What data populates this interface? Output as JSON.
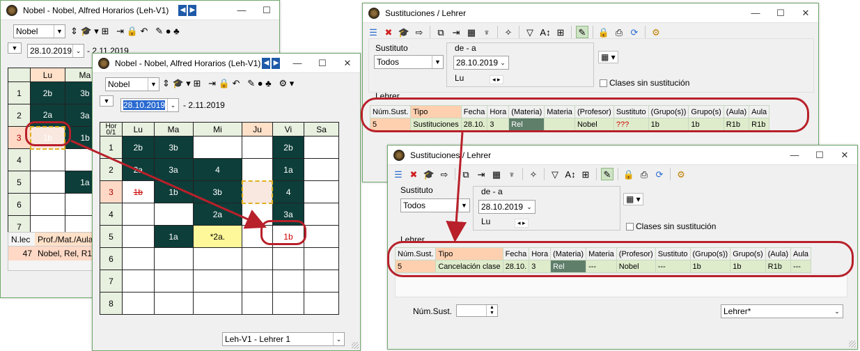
{
  "w1": {
    "title": "Nobel - Nobel, Alfred  Horarios  (Leh-V1)",
    "teacher": "Nobel",
    "date": "28.10.2019",
    "date_to": "- 2.11.2019",
    "days": [
      "Lu",
      "Ma"
    ],
    "rows": [
      "1",
      "2",
      "3",
      "4",
      "5",
      "6",
      "7"
    ],
    "cells": [
      [
        "2b",
        "3b"
      ],
      [
        "2a",
        "3a"
      ],
      [
        "1b",
        "1b"
      ],
      [
        "",
        ""
      ],
      [
        "",
        "1a"
      ],
      [
        "",
        ""
      ],
      [
        "",
        ""
      ]
    ],
    "bottom": {
      "h1": "N.lec",
      "h2": "Prof./Mat./Aula",
      "v1": "47",
      "v2": "Nobel, Rel, R1"
    }
  },
  "w2": {
    "title": "Nobel - Nobel, Alfred  Horarios  (Leh-V1)",
    "teacher": "Nobel",
    "date": "28.10.2019",
    "date_to": "- 2.11.2019",
    "corner": "Hor 0/1",
    "days": [
      "Lu",
      "Ma",
      "Mi",
      "Ju",
      "Vi",
      "Sa"
    ],
    "rows": [
      "1",
      "2",
      "3",
      "4",
      "5",
      "6",
      "7",
      "8"
    ],
    "cells": [
      [
        "2b",
        "3b",
        "",
        "",
        "2b",
        ""
      ],
      [
        "2a",
        "3a",
        "4",
        "",
        "1a",
        ""
      ],
      [
        "1b",
        "1b",
        "3b",
        "",
        "4",
        ""
      ],
      [
        "",
        "",
        "2a",
        "",
        "3a",
        ""
      ],
      [
        "",
        "1a",
        "*2a.",
        "",
        "1b",
        ""
      ],
      [
        "",
        "",
        "",
        "",
        "",
        ""
      ],
      [
        "",
        "",
        "",
        "",
        "",
        ""
      ],
      [
        "",
        "",
        "",
        "",
        "",
        ""
      ]
    ],
    "footer": "Leh-V1 - Lehrer 1"
  },
  "w3": {
    "title": "Sustituciones / Lehrer",
    "sust_label": "Sustituto",
    "sust_value": "Todos",
    "range_label": "de - a",
    "date": "28.10.2019",
    "day": "Lu",
    "no_sub": "Clases sin sustitución",
    "section": "Lehrer",
    "headers": [
      "Núm.Sust.",
      "Tipo",
      "Fecha",
      "Hora",
      "(Materia)",
      "Materia",
      "(Profesor)",
      "Sustituto",
      "(Grupo(s))",
      "Grupo(s)",
      "(Aula)",
      "Aula"
    ],
    "row": [
      "5",
      "Sustituciones",
      "28.10.",
      "3",
      "Rel",
      "",
      "Nobel",
      "???",
      "1b",
      "1b",
      "R1b",
      "R1b"
    ]
  },
  "w4": {
    "title": "Sustituciones / Lehrer",
    "sust_label": "Sustituto",
    "sust_value": "Todos",
    "range_label": "de - a",
    "date": "28.10.2019",
    "day": "Lu",
    "no_sub": "Clases sin sustitución",
    "section": "Lehrer",
    "headers": [
      "Núm.Sust.",
      "Tipo",
      "Fecha",
      "Hora",
      "(Materia)",
      "Materia",
      "(Profesor)",
      "Sustituto",
      "(Grupo(s))",
      "Grupo(s)",
      "(Aula)",
      "Aula"
    ],
    "row": [
      "5",
      "Cancelación clase",
      "28.10.",
      "3",
      "Rel",
      "---",
      "Nobel",
      "---",
      "1b",
      "1b",
      "R1b",
      "---"
    ],
    "num_label": "Núm.Sust.",
    "footer": "Lehrer*"
  },
  "colors": {
    "dark_cell": "#0d3e3a",
    "annotation": "#b8202a",
    "header_green": "#e8f0e0"
  }
}
